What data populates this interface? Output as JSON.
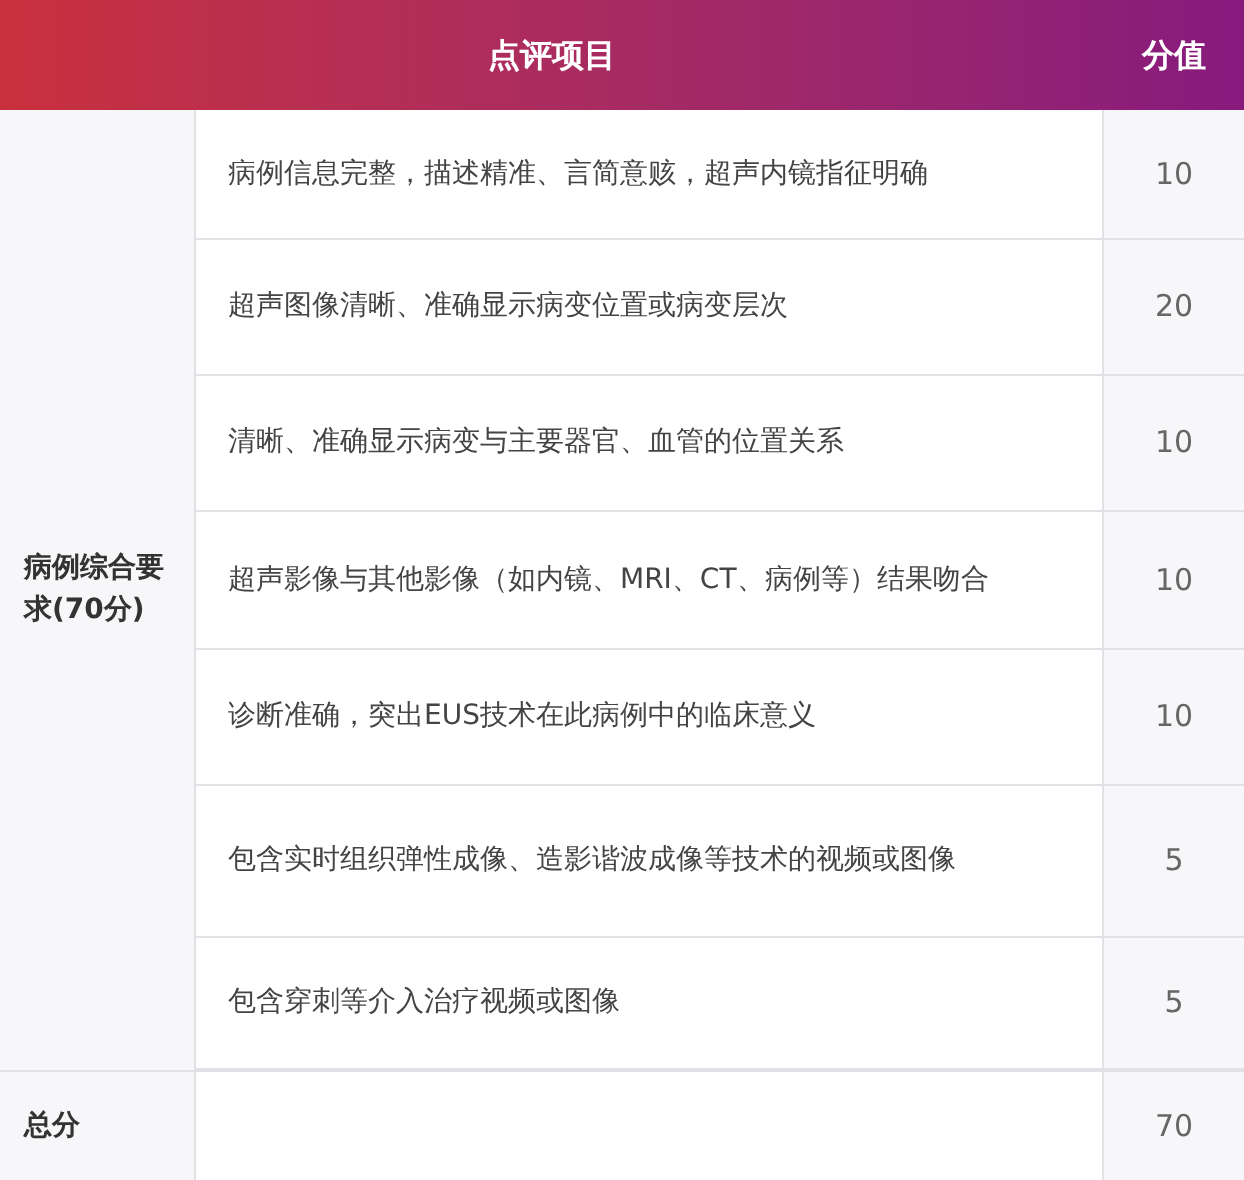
{
  "header": {
    "columns": [
      "点评项目",
      "分值"
    ]
  },
  "group": {
    "label": "病例综合要求(70分)",
    "items": [
      {
        "criterion": "病例信息完整，描述精准、言简意赅，超声内镜指征明确",
        "score": "10"
      },
      {
        "criterion": "超声图像清晰、准确显示病变位置或病变层次",
        "score": "20"
      },
      {
        "criterion": "清晰、准确显示病变与主要器官、血管的位置关系",
        "score": "10"
      },
      {
        "criterion": "超声影像与其他影像（如内镜、MRI、CT、病例等）结果吻合",
        "score": "10"
      },
      {
        "criterion": "诊断准确，突出EUS技术在此病例中的临床意义",
        "score": "10"
      },
      {
        "criterion": "包含实时组织弹性成像、造影谐波成像等技术的视频或图像",
        "score": "5"
      },
      {
        "criterion": "包含穿刺等介入治疗视频或图像",
        "score": "5"
      }
    ]
  },
  "total": {
    "label": "总分",
    "score": "70"
  }
}
